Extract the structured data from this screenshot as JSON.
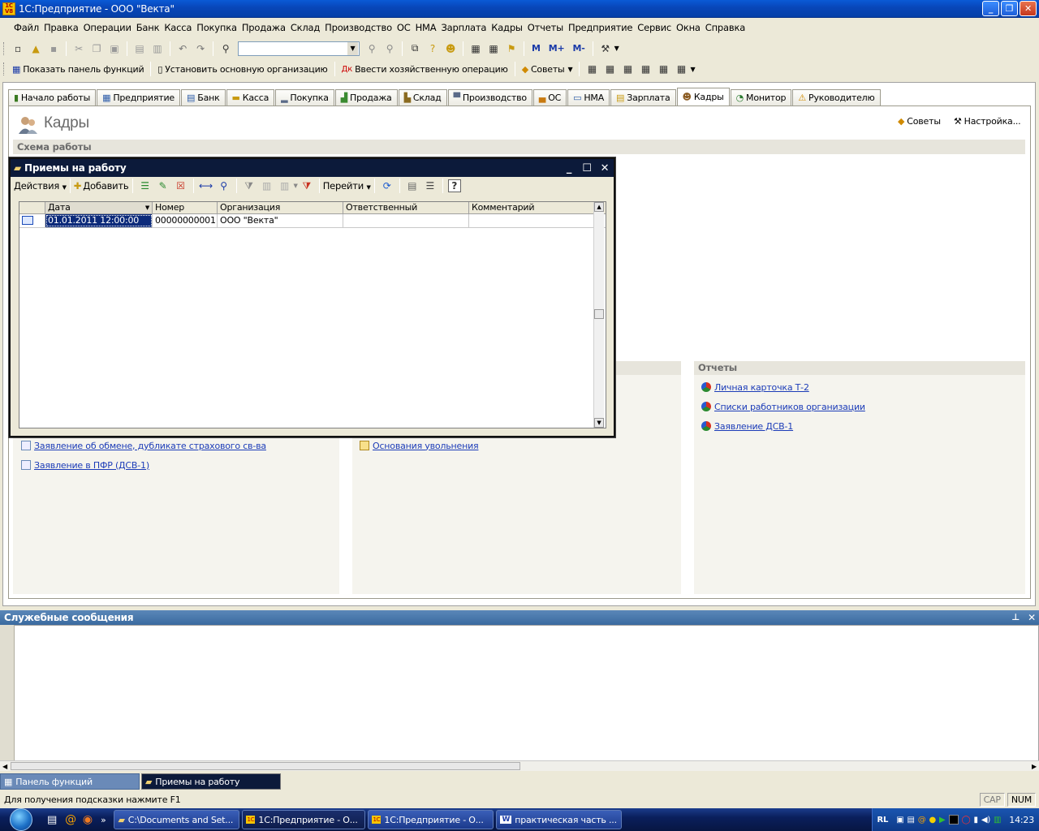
{
  "app": {
    "title": "1С:Предприятие - ООО \"Векта\"",
    "logo": "1С V8"
  },
  "menu": [
    "Файл",
    "Правка",
    "Операции",
    "Банк",
    "Касса",
    "Покупка",
    "Продажа",
    "Склад",
    "Производство",
    "ОС",
    "НМА",
    "Зарплата",
    "Кадры",
    "Отчеты",
    "Предприятие",
    "Сервис",
    "Окна",
    "Справка"
  ],
  "toolbar1": {
    "m": "M",
    "mplus": "M+",
    "mminus": "M-"
  },
  "toolbar2": {
    "show_panel": "Показать панель функций",
    "set_org": "Установить основную организацию",
    "enter_op": "Ввести хозяйственную операцию",
    "tips": "Советы"
  },
  "tabs": [
    {
      "label": "Начало работы",
      "icon": "start-icon"
    },
    {
      "label": "Предприятие",
      "icon": "enterprise-icon"
    },
    {
      "label": "Банк",
      "icon": "bank-icon"
    },
    {
      "label": "Касса",
      "icon": "cash-icon"
    },
    {
      "label": "Покупка",
      "icon": "purchase-icon"
    },
    {
      "label": "Продажа",
      "icon": "sale-icon"
    },
    {
      "label": "Склад",
      "icon": "warehouse-icon"
    },
    {
      "label": "Производство",
      "icon": "production-icon"
    },
    {
      "label": "ОС",
      "icon": "fixed-assets-icon"
    },
    {
      "label": "НМА",
      "icon": "intangibles-icon"
    },
    {
      "label": "Зарплата",
      "icon": "salary-icon"
    },
    {
      "label": "Кадры",
      "icon": "personnel-icon"
    },
    {
      "label": "Монитор",
      "icon": "monitor-icon"
    },
    {
      "label": "Руководителю",
      "icon": "warning-icon"
    }
  ],
  "page": {
    "title": "Кадры",
    "tips": "Советы",
    "settings": "Настройка...",
    "schema": "Схема работы",
    "reports_title": "Отчеты"
  },
  "reports": [
    "Личная карточка Т-2",
    "Списки работников организации",
    "Заявление ДСВ-1"
  ],
  "left_links": [
    "Заявление об обмене, дубликате страхового св-ва",
    "Заявление в ПФР (ДСВ-1)"
  ],
  "mid_links": [
    "Основания увольнения"
  ],
  "modal": {
    "title": "Приемы на работу",
    "actions": "Действия",
    "add": "Добавить",
    "goto": "Перейти",
    "help": "?",
    "columns": [
      "Дата",
      "Номер",
      "Организация",
      "Ответственный",
      "Комментарий"
    ],
    "rows": [
      [
        "01.01.2011 12:00:00",
        "00000000001",
        "ООО \"Векта\"",
        "",
        ""
      ]
    ]
  },
  "messages": {
    "title": "Служебные сообщения",
    "pin": "ꟷ",
    "close": "✕"
  },
  "wintabs": [
    "Панель функций",
    "Приемы на работу"
  ],
  "status": {
    "hint": "Для получения подсказки нажмите F1",
    "cap": "CAP",
    "num": "NUM"
  },
  "taskbar": {
    "items": [
      "C:\\Documents and Set...",
      "1С:Предприятие - О...",
      "1С:Предприятие - О...",
      "практическая часть ..."
    ],
    "lang": "RL",
    "time": "14:23"
  }
}
